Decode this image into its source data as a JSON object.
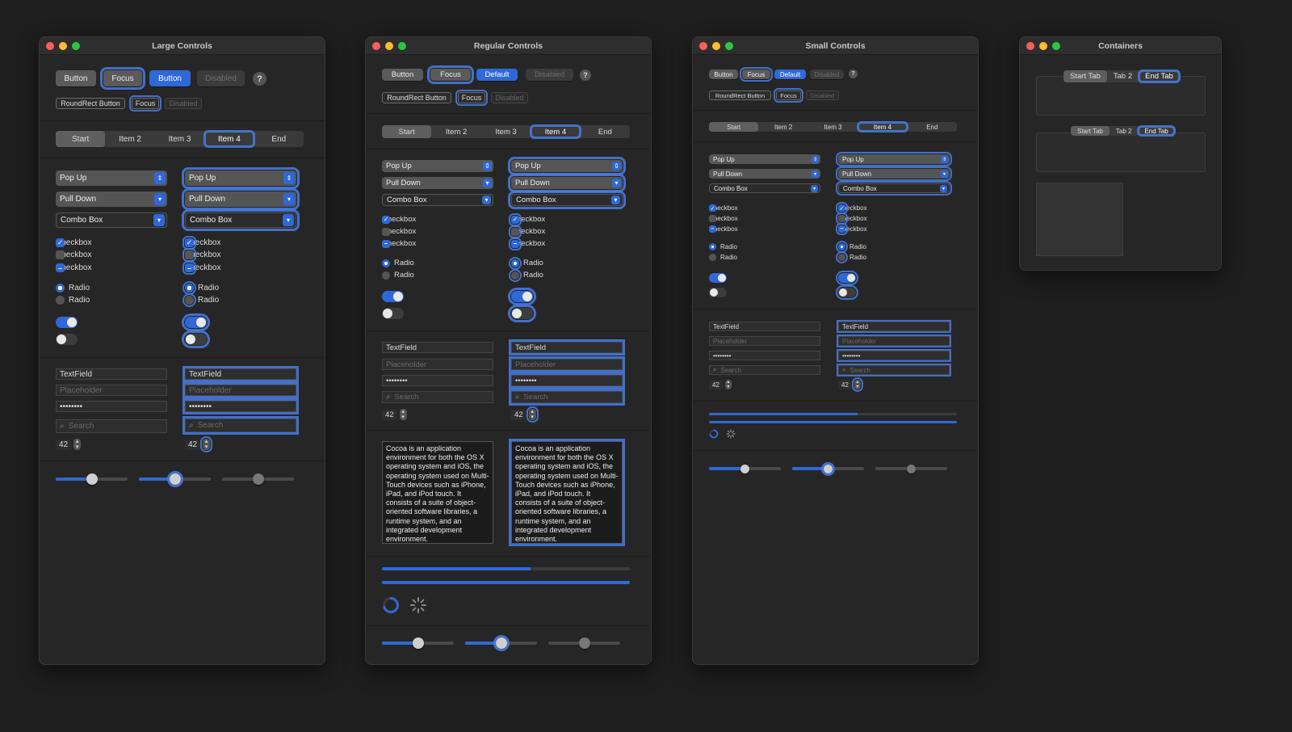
{
  "windows": [
    {
      "title": "Large Controls"
    },
    {
      "title": "Regular Controls"
    },
    {
      "title": "Small Controls"
    },
    {
      "title": "Containers"
    }
  ],
  "buttons": {
    "button": "Button",
    "focus": "Focus",
    "default": "Default",
    "disabled": "Disabled",
    "help": "?"
  },
  "roundrect": {
    "button": "RoundRect Button",
    "focus": "Focus",
    "disabled": "Disabled"
  },
  "segments": [
    "Start",
    "Item 2",
    "Item 3",
    "Item 4",
    "End"
  ],
  "popups": {
    "popup": "Pop Up",
    "pulldown": "Pull Down",
    "combo": "Combo Box"
  },
  "checkbox_label": "Checkbox",
  "radio_label": "Radio",
  "fields": {
    "textfield": "TextField",
    "placeholder": "Placeholder",
    "password": "••••••••",
    "search": "Search",
    "stepper": "42"
  },
  "textview": "Cocoa is an application environment for both the OS X operating system and iOS, the operating system used on Multi-Touch devices such as iPhone, iPad, and iPod touch. It consists of a suite of object-oriented software libraries, a runtime system, and an integrated development environment.",
  "tabs": [
    "Start Tab",
    "Tab 2",
    "End Tab"
  ],
  "progress": {
    "determinate": 0.6,
    "full": 1.0
  },
  "sliders": [
    0.5,
    0.5,
    0.5
  ],
  "colors": {
    "accent": "#2f68d8",
    "background": "#1e1e1e",
    "window": "#262626"
  }
}
